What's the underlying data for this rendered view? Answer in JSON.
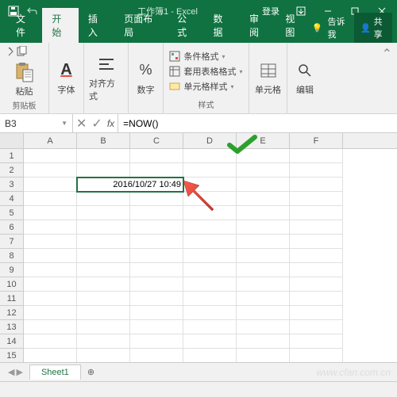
{
  "title": "工作簿1 - Excel",
  "login": "登录",
  "tabs": {
    "file": "文件",
    "home": "开始",
    "insert": "插入",
    "layout": "页面布局",
    "formula": "公式",
    "data": "数据",
    "review": "审阅",
    "view": "视图",
    "tellme": "告诉我",
    "share": "共享"
  },
  "ribbon": {
    "clipboard": {
      "paste": "粘贴",
      "label": "剪贴板"
    },
    "font": {
      "btn": "字体",
      "label": ""
    },
    "align": {
      "btn": "对齐方式",
      "label": ""
    },
    "number": {
      "btn": "数字",
      "label": ""
    },
    "styles": {
      "cond": "条件格式",
      "table": "套用表格格式",
      "cell": "单元格样式",
      "label": "样式"
    },
    "cells": {
      "btn": "单元格",
      "label": ""
    },
    "edit": {
      "btn": "编辑",
      "label": ""
    }
  },
  "namebox": "B3",
  "formula": "=NOW()",
  "columns": [
    "A",
    "B",
    "C",
    "D",
    "E",
    "F"
  ],
  "cellB3": "2016/10/27 10:49",
  "sheet": "Sheet1",
  "watermark": "www.cfan.com.cn"
}
